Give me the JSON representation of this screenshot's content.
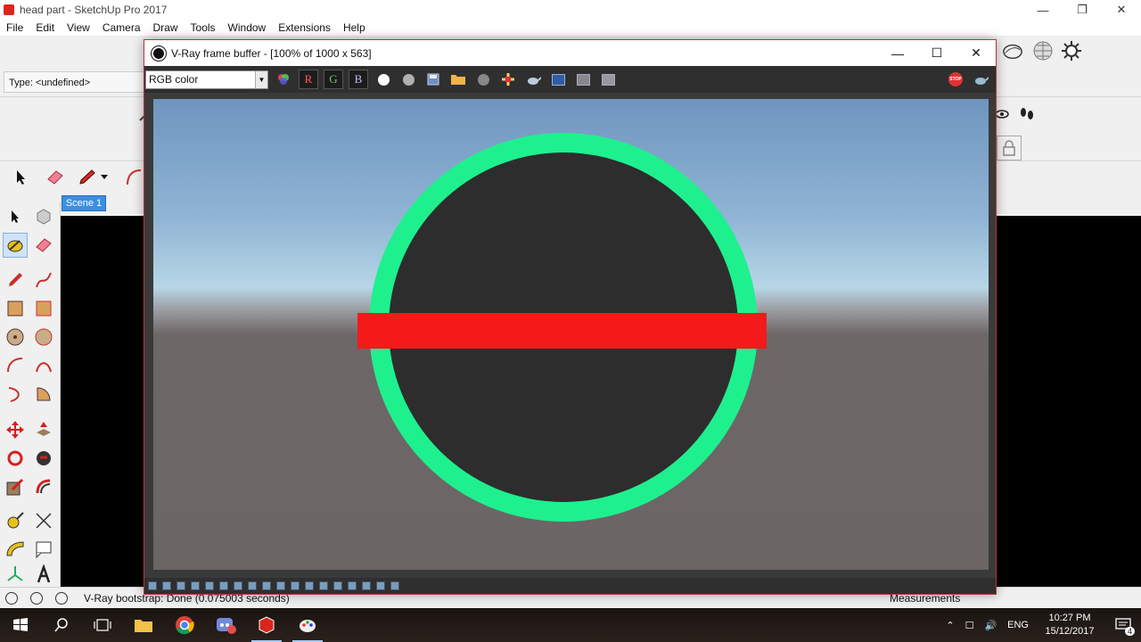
{
  "sketchup": {
    "window_title": "head part - SketchUp Pro 2017",
    "menus": [
      "File",
      "Edit",
      "View",
      "Camera",
      "Draw",
      "Tools",
      "Window",
      "Extensions",
      "Help"
    ],
    "type_field": "Type: <undefined>",
    "scene_tab": "Scene 1",
    "status_text": "V-Ray bootstrap: Done (0.075003 seconds)",
    "measurements_label": "Measurements"
  },
  "vfb": {
    "title": "V-Ray frame buffer - [100% of 1000 x 563]",
    "channel": "RGB color",
    "btn_r": "R",
    "btn_g": "G",
    "btn_b": "B",
    "stop_label": "STOP",
    "render": {
      "ring_color": "#1ff08e",
      "disc_color": "#2d2d2d",
      "band_color": "#f51a1a"
    }
  },
  "taskbar": {
    "language": "ENG",
    "time": "10:27 PM",
    "date": "15/12/2017",
    "notification_count": "4"
  }
}
